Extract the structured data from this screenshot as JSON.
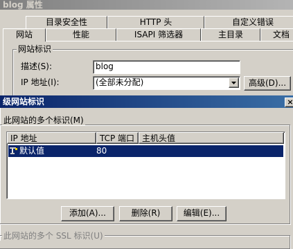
{
  "background_dialog": {
    "title": "blog 属性",
    "tabs_row1": [
      "目录安全性",
      "HTTP 头",
      "自定义错误"
    ],
    "tabs_row2": [
      "网站",
      "性能",
      "ISAPI 筛选器",
      "主目录",
      "文档"
    ],
    "group_label": "网站标识",
    "description_label": "描述(S):",
    "description_value": "blog",
    "ip_label": "IP 地址(I):",
    "ip_value": "(全部未分配)",
    "advanced_button": "高级(D)..."
  },
  "dialog": {
    "title": "级网站标识",
    "close_glyph": "×",
    "group_label": "此网站的多个标识(M)",
    "columns": [
      "IP 地址",
      "TCP 端口",
      "主机头值"
    ],
    "rows": [
      {
        "ip": "默认值",
        "port": "80",
        "host": ""
      }
    ],
    "buttons": {
      "add": "添加(A)...",
      "remove": "删除(R)",
      "edit": "编辑(E)..."
    },
    "ssl_group_label": "此网站的多个 SSL 标识(U)"
  },
  "colors": {
    "face": "#d4d0c8",
    "title_active": "#0a246a",
    "selection": "#0a246a"
  }
}
